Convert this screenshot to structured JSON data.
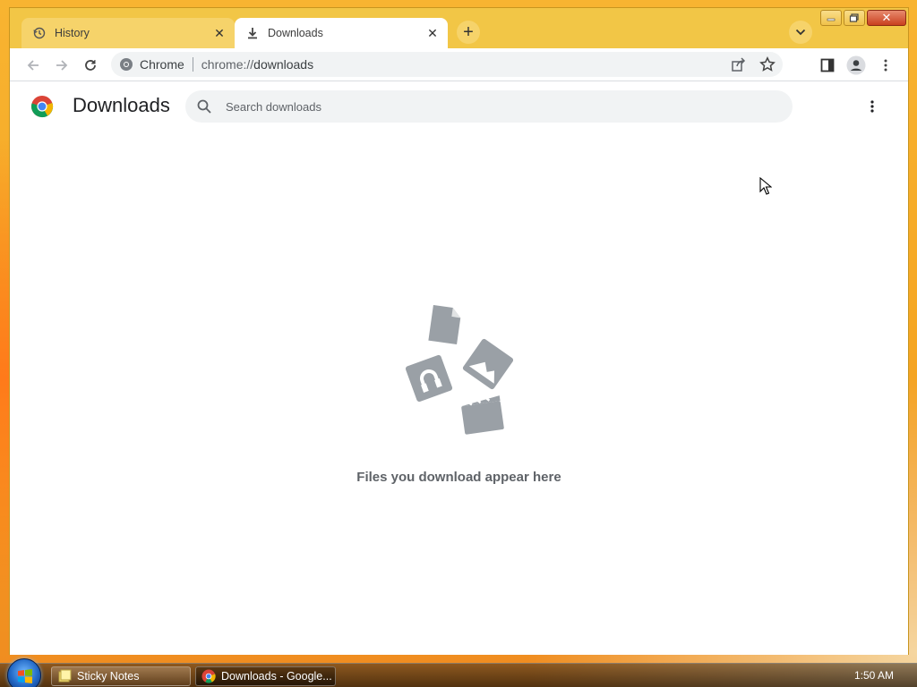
{
  "window": {
    "tabs": [
      {
        "label": "History",
        "icon": "history-icon",
        "active": false
      },
      {
        "label": "Downloads",
        "icon": "download-icon",
        "active": true
      }
    ],
    "new_tab_label": "+"
  },
  "toolbar": {
    "site_name": "Chrome",
    "url_scheme": "chrome://",
    "url_path": "downloads"
  },
  "page": {
    "title": "Downloads",
    "search_placeholder": "Search downloads",
    "empty_message": "Files you download appear here"
  },
  "taskbar": {
    "items": [
      {
        "label": "Sticky Notes",
        "icon": "sticky-notes-icon"
      },
      {
        "label": "Downloads - Google...",
        "icon": "chrome-icon"
      }
    ],
    "clock": "1:50 AM"
  },
  "colors": {
    "frame": "#f2c646",
    "inactive_tab": "#f6d36a",
    "empty_illustration": "#9aa0a6",
    "text_secondary": "#5f6368"
  }
}
